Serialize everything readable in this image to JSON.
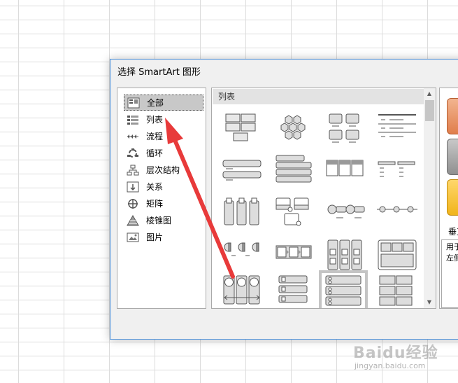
{
  "dialog": {
    "title": "选择 SmartArt 图形"
  },
  "categories": [
    {
      "label": "全部",
      "icon": "all-icon",
      "selected": true
    },
    {
      "label": "列表",
      "icon": "list-icon"
    },
    {
      "label": "流程",
      "icon": "process-icon"
    },
    {
      "label": "循环",
      "icon": "cycle-icon"
    },
    {
      "label": "层次结构",
      "icon": "hierarchy-icon"
    },
    {
      "label": "关系",
      "icon": "relationship-icon"
    },
    {
      "label": "矩阵",
      "icon": "matrix-icon"
    },
    {
      "label": "棱锥图",
      "icon": "pyramid-icon"
    },
    {
      "label": "图片",
      "icon": "picture-icon"
    }
  ],
  "gallery": {
    "header": "列表",
    "selected_index": 18,
    "thumbnail_count": 20
  },
  "preview": {
    "name": "垂直",
    "description": "用于\n左侧"
  },
  "watermark": {
    "text": "Baidu经验",
    "url": "jingyan.baidu.com"
  },
  "colors": {
    "dialog_border": "#4a8fd9",
    "arrow": "#e83a3a",
    "selection": "#c8c8c8"
  }
}
